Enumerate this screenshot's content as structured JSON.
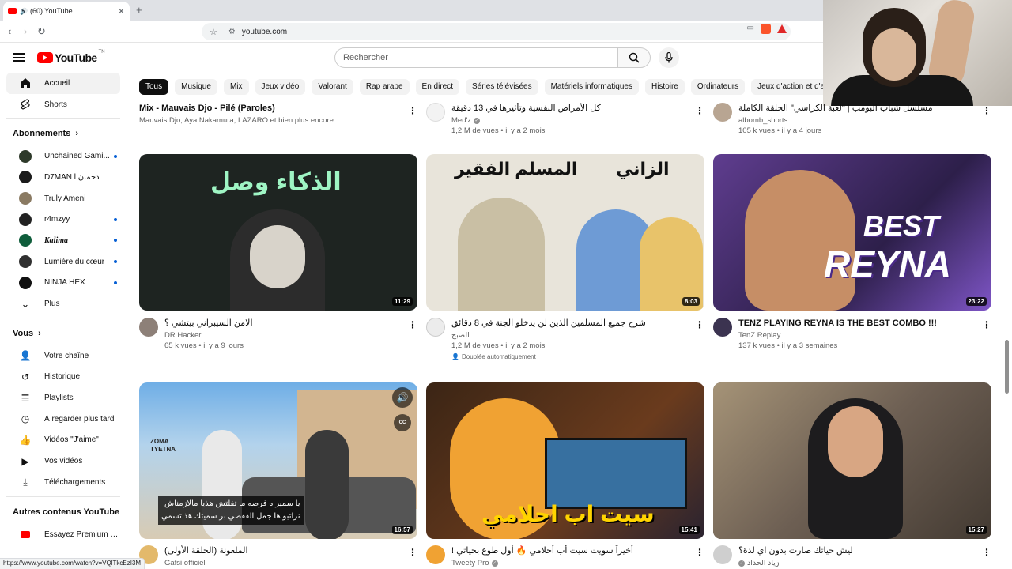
{
  "browser": {
    "tab_title": "(60) YouTube",
    "url": "youtube.com"
  },
  "masthead": {
    "logo_text": "YouTube",
    "logo_region": "TN",
    "search_placeholder": "Rechercher"
  },
  "sidebar": {
    "main": [
      {
        "label": "Accueil",
        "icon": "home-icon",
        "active": true
      },
      {
        "label": "Shorts",
        "icon": "shorts-icon"
      }
    ],
    "subscriptions_title": "Abonnements",
    "subscriptions": [
      {
        "label": "Unchained Gami...",
        "dot": true,
        "color": "#2e3a2a"
      },
      {
        "label": "D7MAN l دحمان",
        "dot": false,
        "color": "#1b1b1b"
      },
      {
        "label": "Truly Ameni",
        "dot": false,
        "color": "#8a7a62"
      },
      {
        "label": "r4mzyy",
        "dot": true,
        "color": "#222222"
      },
      {
        "label": "Kalima",
        "dot": true,
        "color": "#0f5d3b"
      },
      {
        "label": "Lumière du cœur",
        "dot": true,
        "color": "#303030"
      },
      {
        "label": "NINJA HEX",
        "dot": true,
        "color": "#111111"
      }
    ],
    "more_label": "Plus",
    "you_title": "Vous",
    "you_items": [
      {
        "label": "Votre chaîne",
        "icon": "channel-icon"
      },
      {
        "label": "Historique",
        "icon": "history-icon"
      },
      {
        "label": "Playlists",
        "icon": "playlists-icon"
      },
      {
        "label": "À regarder plus tard",
        "icon": "watch-later-icon"
      },
      {
        "label": "Vidéos \"J'aime\"",
        "icon": "like-icon"
      },
      {
        "label": "Vos vidéos",
        "icon": "your-videos-icon"
      },
      {
        "label": "Téléchargements",
        "icon": "download-icon"
      }
    ],
    "other_title": "Autres contenus YouTube",
    "other_items": [
      {
        "label": "Essayez Premium p...",
        "icon": "premium-icon"
      }
    ]
  },
  "chips": [
    "Tous",
    "Musique",
    "Mix",
    "Jeux vidéo",
    "Valorant",
    "Rap arabe",
    "En direct",
    "Séries télévisées",
    "Matériels informatiques",
    "Histoire",
    "Ordinateurs",
    "Jeux d'action et d'aventure"
  ],
  "row0": [
    {
      "title": "Mix - Mauvais Djo - Pilé (Paroles)",
      "channel": "Mauvais Djo, Aya Nakamura, LAZARO et bien plus encore",
      "stats": ""
    },
    {
      "title": "كل الأمراض النفسية وتأثيرها في 13 دقيقة",
      "channel": "Med'z",
      "stats": "1,2 M de vues • il y a 2 mois",
      "verified": true
    },
    {
      "title": "مسلسل شباب البومب | \"لعبة الكراسي\" الحلقة الكاملة",
      "channel": "albomb_shorts",
      "stats": "105 k vues • il y a 4 jours"
    }
  ],
  "row1": [
    {
      "title": "الامن السيبراني بيتشي ؟",
      "channel": "DR Hacker",
      "stats": "65 k vues • il y a 9 jours",
      "duration": "11:29",
      "thumb_text": "الذكاء وصل"
    },
    {
      "title": "شرح جميع المسلمين الذين لن يدخلو الجنة في 8 دقائق",
      "channel": "الصبح",
      "stats": "1,2 M de vues • il y a 2 mois",
      "duration": "8:03",
      "dubbed": "Doublée automatiquement",
      "thumb_text_left": "المسلم الفقير",
      "thumb_text_right": "الزاني"
    },
    {
      "title": "TENZ PLAYING REYNA IS THE BEST COMBO !!!",
      "channel": "TenZ Replay",
      "stats": "137 k vues • il y a 3 semaines",
      "duration": "23:22",
      "thumb_best": "BEST",
      "thumb_reyna": "REYNA"
    }
  ],
  "row2": [
    {
      "title": "الملعونة (الحلقة الأولى)",
      "channel": "Gafsi officiel",
      "duration": "16:57",
      "subtitle_line1": "يا سمير ه فرصه ما تفلتش هذيا مالازمناش",
      "subtitle_line2": "نراتبو ها جمل القفصي بر سميتك هذ تسمي",
      "thumb_text": "ZOMA TYETNA",
      "cc": "CC"
    },
    {
      "title": "أخيراً سويت سيت أب أحلامي 🔥 أول طوع بحياتي !",
      "channel": "Tweety Pro",
      "duration": "15:41",
      "verified": true,
      "thumb_text": "سيت اب احلامي"
    },
    {
      "title": "ليش حياتك صارت بدون اي لذة؟",
      "channel": "زياد الحداد",
      "duration": "15:27",
      "verified": true
    }
  ],
  "statusbar": "https://www.youtube.com/watch?v=VQlTkcEzI3M"
}
